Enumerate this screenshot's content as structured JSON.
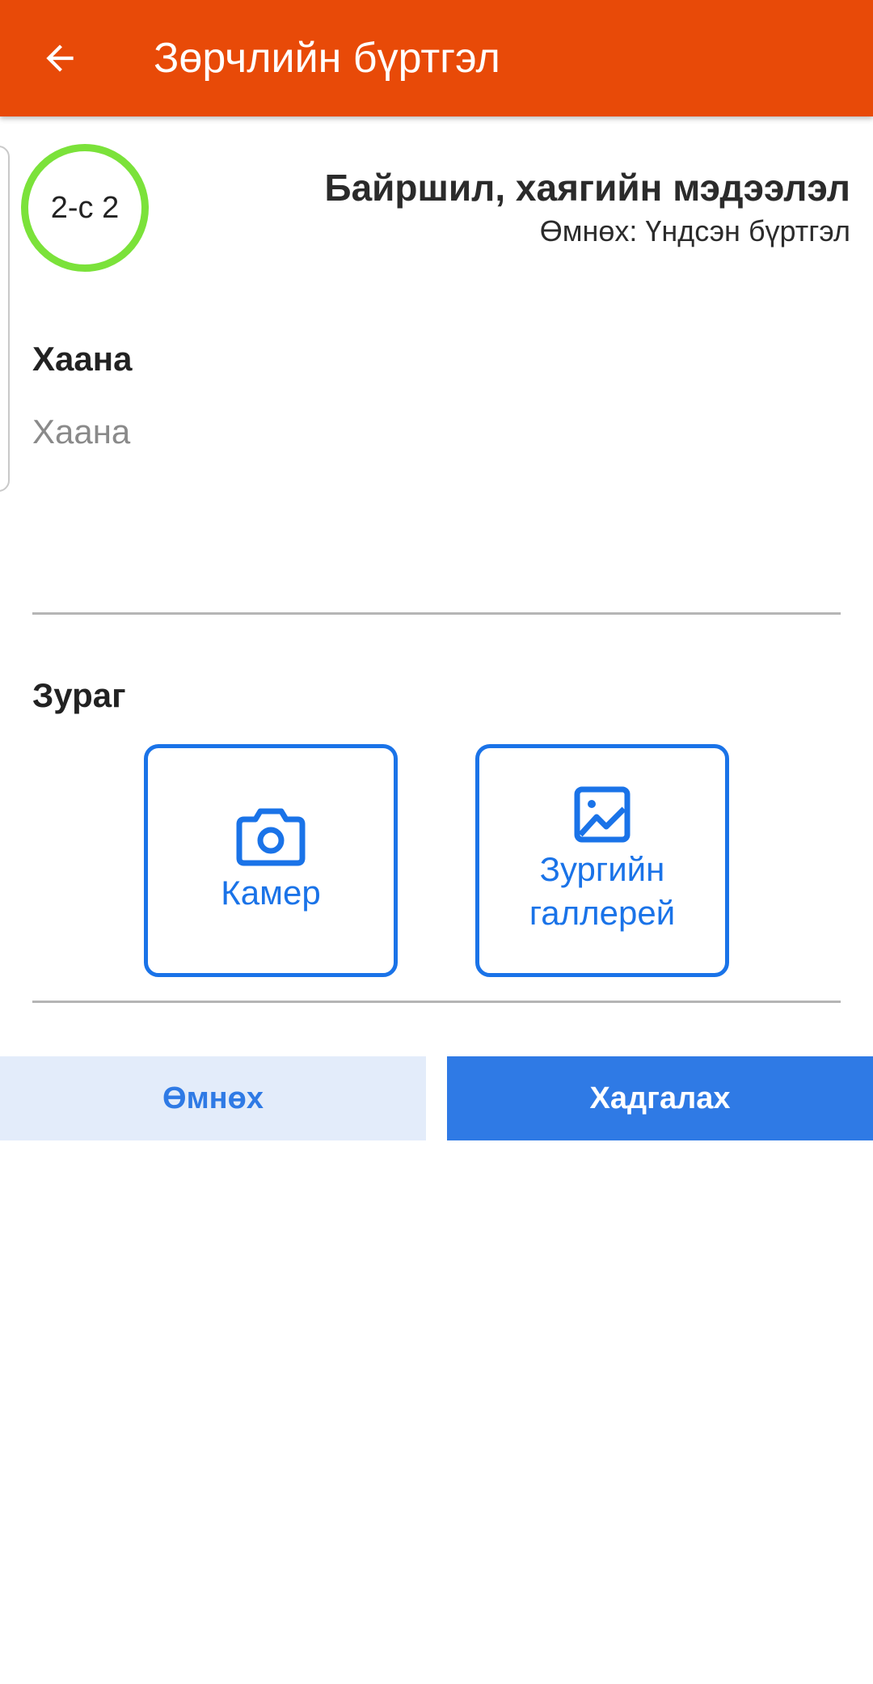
{
  "appbar": {
    "title": "Зөрчлийн бүртгэл",
    "back_icon": "arrow-left-icon",
    "background": "#E84A08"
  },
  "step": {
    "counter": "2-с 2",
    "title": "Байршил, хаягийн мэдээлэл",
    "previous": "Өмнөх: Үндсэн бүртгэл",
    "ring_color": "#7BE23A"
  },
  "where": {
    "label": "Хаана",
    "value": "",
    "placeholder": "Хаана"
  },
  "photo": {
    "label": "Зураг",
    "camera_label": "Камер",
    "camera_icon": "camera-icon",
    "gallery_label": "Зургийн галлерей",
    "gallery_icon": "image-icon",
    "accent": "#1A73E8"
  },
  "actions": {
    "prev_label": "Өмнөх",
    "save_label": "Хадгалах",
    "primary": "#2F7AE5"
  }
}
